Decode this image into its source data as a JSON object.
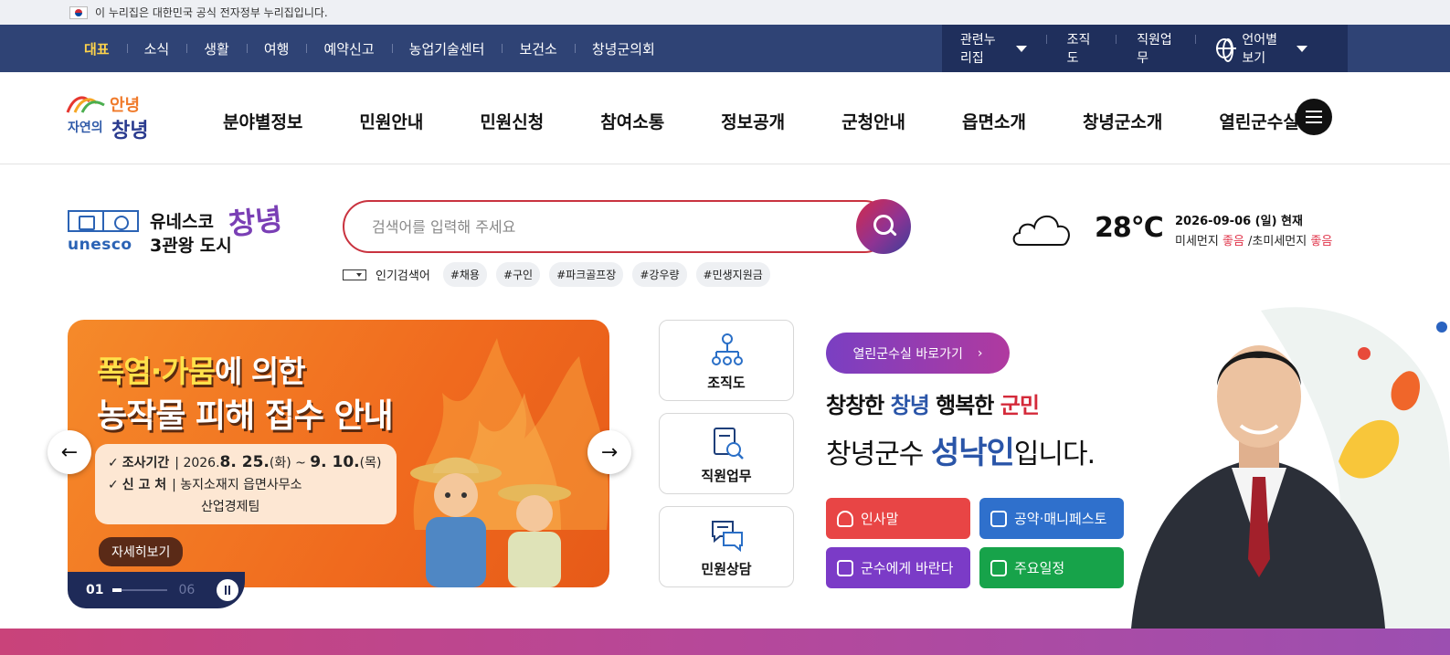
{
  "gov_banner": {
    "text": "이 누리집은 대한민국 공식 전자정부 누리집입니다."
  },
  "top_nav": {
    "items": [
      "대표",
      "소식",
      "생활",
      "여행",
      "예약신고",
      "농업기술센터",
      "보건소",
      "창녕군의회"
    ],
    "right": {
      "related": "관련누리집",
      "org": "조직도",
      "staff": "직원업무",
      "language": "언어별보기"
    }
  },
  "logo": {
    "line1": "안녕",
    "line2": "자연의",
    "line3": "창녕"
  },
  "gnb": [
    "분야별정보",
    "민원안내",
    "민원신청",
    "참여소통",
    "정보공개",
    "군청안내",
    "읍면소개",
    "창녕군소개",
    "열린군수실"
  ],
  "unesco": {
    "word": "unesco",
    "line1": "유네스코",
    "line2": "3관왕 도시",
    "script": "창녕"
  },
  "search": {
    "placeholder": "검색어를 입력해 주세요",
    "popular_label": "인기검색어",
    "tags": [
      "#채용",
      "#구인",
      "#파크골프장",
      "#강우량",
      "#민생지원금"
    ]
  },
  "weather": {
    "temp": "28°C",
    "date": "2026-09-06 (일) 현재",
    "fine_dust_label": "미세먼지",
    "fine_dust_value": "좋음",
    "ultra_dust_label": "초미세먼지",
    "ultra_dust_value": "좋음"
  },
  "banner": {
    "title_a": "폭염·가뭄",
    "title_b": "에 의한",
    "title_2": "농작물 피해 접수 안내",
    "period_label": "조사기간",
    "period_value_pre": "2026.",
    "period_value_md1": "8. 25.",
    "period_value_mid": "(화) ~ ",
    "period_value_md2": "9. 10.",
    "period_value_post": "(목)",
    "place_label": "신 고 처",
    "place_value": "농지소재지 읍면사무소",
    "place_value2": "산업경제팀",
    "detail": "자세히보기",
    "current": "01",
    "total": "06"
  },
  "quick_links": [
    {
      "label": "조직도"
    },
    {
      "label": "직원업무"
    },
    {
      "label": "민원상담"
    }
  ],
  "mayor": {
    "open_office": "열린군수실 바로가기",
    "slogan_1": "창창한",
    "slogan_2": "창녕",
    "slogan_3": "행복한",
    "slogan_4": "군민",
    "line_pre": "창녕군수 ",
    "name": "성낙인",
    "line_post": "입니다.",
    "actions": [
      "인사말",
      "공약·매니페스토",
      "군수에게 바란다",
      "주요일정"
    ]
  },
  "colors": {
    "nav_bg": "#2f4375",
    "nav_active": "#ffd44b",
    "search_border": "#c9333f",
    "good": "#e0344a"
  }
}
